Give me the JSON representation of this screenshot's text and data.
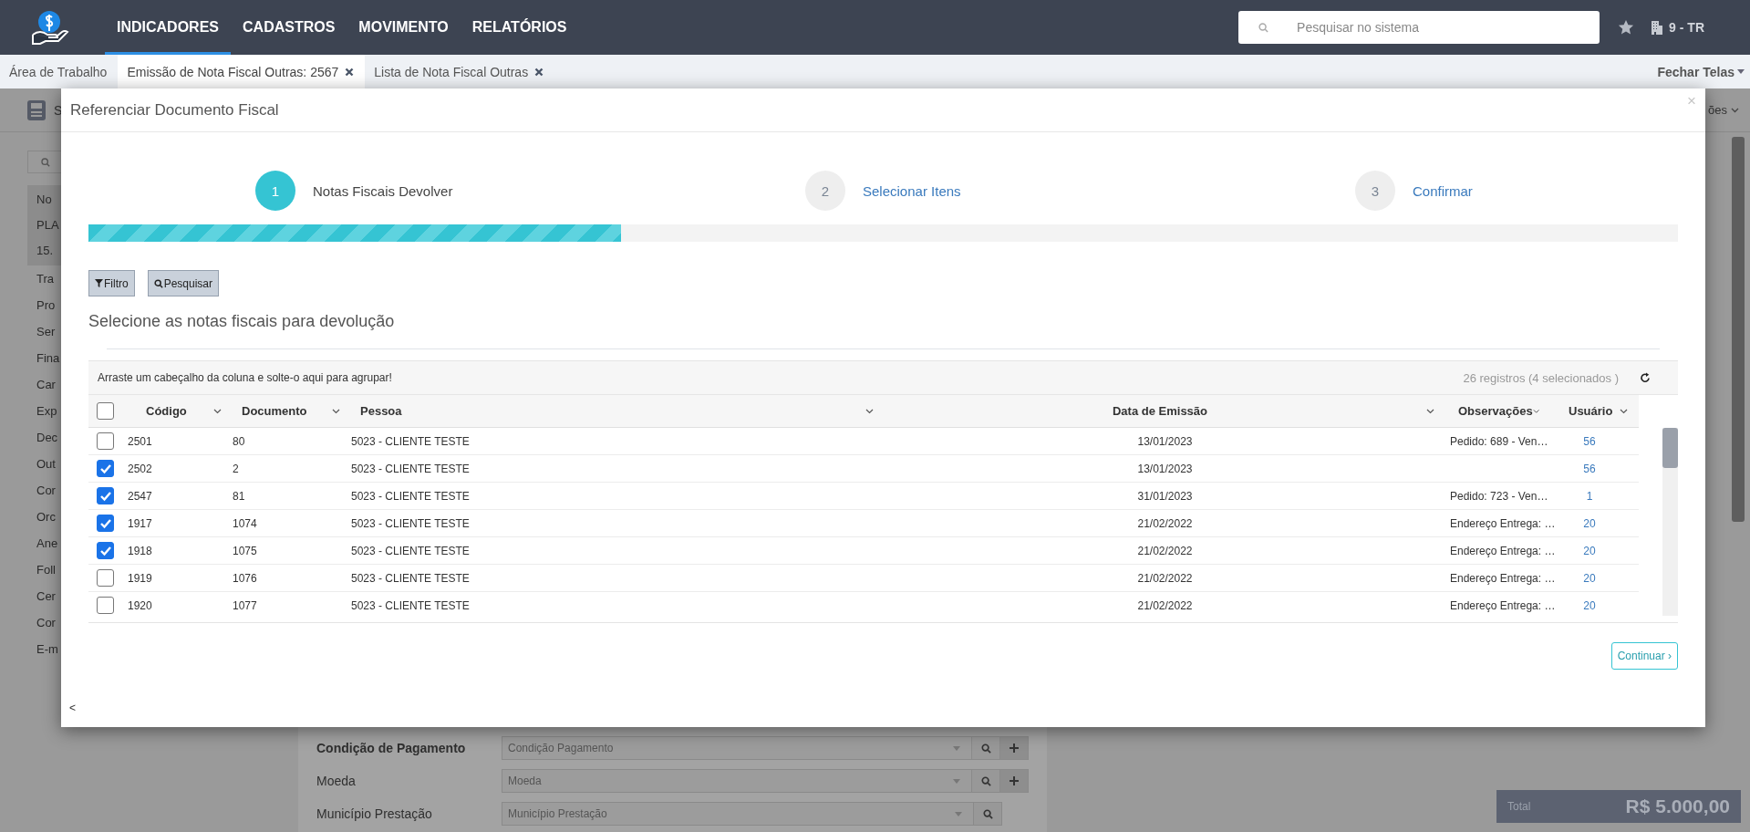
{
  "nav": {
    "menu": [
      {
        "label": "INDICADORES",
        "selected": true
      },
      {
        "label": "CADASTROS",
        "selected": false
      },
      {
        "label": "MOVIMENTO",
        "selected": false
      },
      {
        "label": "RELATÓRIOS",
        "selected": false
      }
    ],
    "search": {
      "placeholder": "Pesquisar no sistema"
    },
    "company": "9 - TR"
  },
  "tabs": [
    {
      "label": "Área de Trabalho",
      "selected": false,
      "closable": false
    },
    {
      "label": "Emissão de Nota Fiscal Outras: 2567",
      "selected": true,
      "closable": true
    },
    {
      "label": "Lista de Nota Fiscal Outras",
      "selected": false,
      "closable": true
    }
  ],
  "close_all": "Fechar Telas",
  "toolbar": {
    "save_label": "S",
    "right_label": "ões"
  },
  "sidebar": {
    "items": [
      {
        "text": "No\nPLA\n15.",
        "selected": true
      },
      {
        "text": "Tra",
        "selected": false
      },
      {
        "text": "Pro",
        "selected": false
      },
      {
        "text": "Ser",
        "selected": false
      },
      {
        "text": "Fina",
        "selected": false
      },
      {
        "text": "Car",
        "selected": false
      },
      {
        "text": "Exp",
        "selected": false
      },
      {
        "text": "Dec",
        "selected": false
      },
      {
        "text": "Out",
        "selected": false
      },
      {
        "text": "Cor",
        "selected": false
      },
      {
        "text": "Orc",
        "selected": false
      },
      {
        "text": "Ane",
        "selected": false
      },
      {
        "text": "Foll",
        "selected": false
      },
      {
        "text": "Cer",
        "selected": false
      },
      {
        "text": "Cor",
        "selected": false
      },
      {
        "text": "E-m",
        "selected": false
      }
    ]
  },
  "form": {
    "fields": [
      {
        "label": "Condição de Pagamento",
        "placeholder": "Condição Pagamento",
        "required": true,
        "can_add": true
      },
      {
        "label": "Moeda",
        "placeholder": "Moeda",
        "required": false,
        "can_add": true
      },
      {
        "label": "Município Prestação",
        "placeholder": "Município Prestação",
        "required": false,
        "can_add": false
      }
    ]
  },
  "total": {
    "label": "Total",
    "value": "R$ 5.000,00"
  },
  "modal": {
    "title": "Referenciar Documento Fiscal",
    "close": "×",
    "steps": [
      {
        "number": "1",
        "label": "Notas Fiscais Devolver",
        "selected": true
      },
      {
        "number": "2",
        "label": "Selecionar Itens",
        "selected": false
      },
      {
        "number": "3",
        "label": "Confirmar",
        "selected": false
      }
    ],
    "progress": {
      "level": 0.335
    },
    "buttons": [
      {
        "kind": "filter",
        "label": "Filtro"
      },
      {
        "kind": "search",
        "label": "Pesquisar"
      }
    ],
    "instruction": "Selecione as notas fiscais para devolução",
    "grid": {
      "group_hint": "Arraste um cabeçalho da coluna e solte-o aqui para agrupar!",
      "count": "26 registros (4 selecionados )",
      "all_checked": false,
      "columns": [
        "Código",
        "Documento",
        "Pessoa",
        "Data de Emissão",
        "Observações",
        "Usuário"
      ],
      "rows": [
        {
          "checked": false,
          "code": "2501",
          "document": "80",
          "person": "5023 - CLIENTE TESTE",
          "date": "13/01/2023",
          "notes": "Pedido: 689 - Ven…",
          "user": "56"
        },
        {
          "checked": true,
          "code": "2502",
          "document": "2",
          "person": "5023 - CLIENTE TESTE",
          "date": "13/01/2023",
          "user": "56"
        },
        {
          "checked": true,
          "code": "2547",
          "document": "81",
          "person": "5023 - CLIENTE TESTE",
          "date": "31/01/2023",
          "notes": "Pedido: 723 - Ven…",
          "user": "1"
        },
        {
          "checked": true,
          "code": "1917",
          "document": "1074",
          "person": "5023 - CLIENTE TESTE",
          "date": "21/02/2022",
          "notes": "Endereço Entrega: …",
          "user": "20"
        },
        {
          "checked": true,
          "code": "1918",
          "document": "1075",
          "person": "5023 - CLIENTE TESTE",
          "date": "21/02/2022",
          "notes": "Endereço Entrega: …",
          "user": "20"
        },
        {
          "checked": false,
          "code": "1919",
          "document": "1076",
          "person": "5023 - CLIENTE TESTE",
          "date": "21/02/2022",
          "notes": "Endereço Entrega: …",
          "user": "20"
        },
        {
          "checked": false,
          "code": "1920",
          "document": "1077",
          "person": "5023 - CLIENTE TESTE",
          "date": "21/02/2022",
          "notes": "Endereço Entrega: …",
          "user": "20"
        }
      ]
    },
    "next_button": "Continuar ›",
    "back": "<"
  }
}
